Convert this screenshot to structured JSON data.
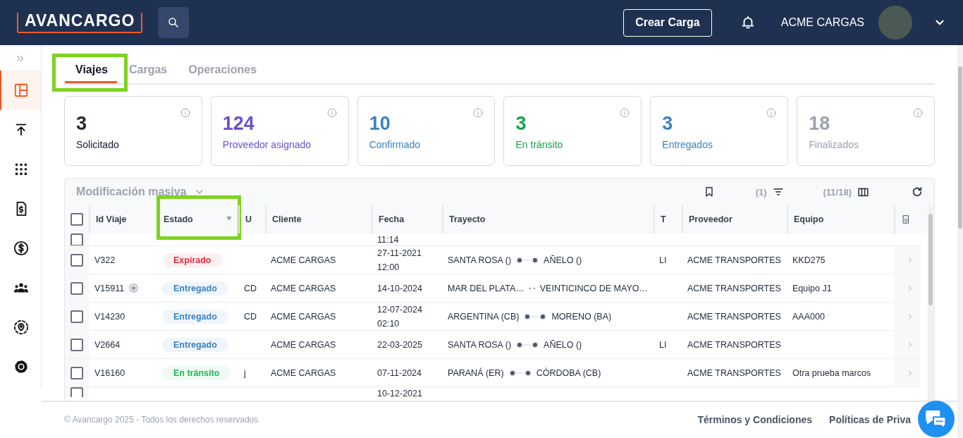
{
  "header": {
    "logo": "AVANCARGO",
    "create_button": "Crear Carga",
    "user_name": "ACME CARGAS"
  },
  "sidebar": {
    "items": [
      {
        "kind": "layout",
        "selected": true
      },
      {
        "kind": "upload",
        "selected": false
      },
      {
        "kind": "apps",
        "selected": false
      },
      {
        "kind": "invoice",
        "selected": false
      },
      {
        "kind": "dollar",
        "selected": false
      },
      {
        "kind": "group",
        "selected": false
      },
      {
        "kind": "location",
        "selected": false
      },
      {
        "kind": "settings",
        "selected": false
      }
    ]
  },
  "tabs": [
    {
      "label": "Viajes",
      "selected": true,
      "highlighted": true
    },
    {
      "label": "Cargas",
      "selected": false,
      "highlighted": false
    },
    {
      "label": "Operaciones",
      "selected": false,
      "highlighted": false
    }
  ],
  "summary_cards": [
    {
      "count": "3",
      "label": "Solicitado",
      "color": "#1f2937"
    },
    {
      "count": "124",
      "label": "Proveedor asignado",
      "color": "#6b4fcf"
    },
    {
      "count": "10",
      "label": "Confirmado",
      "color": "#3b82c4"
    },
    {
      "count": "3",
      "label": "En tránsito",
      "color": "#16a34a"
    },
    {
      "count": "3",
      "label": "Entregados",
      "color": "#3b82c4"
    },
    {
      "count": "18",
      "label": "Finalizados",
      "color": "#9ca3af"
    }
  ],
  "table": {
    "bulk_action": "Modificación masiva",
    "filter_count": "(1)",
    "column_count": "(11/18)",
    "all_checked": false,
    "columns": [
      {
        "label": "Id Viaje",
        "filter_icon": false,
        "highlighted": false
      },
      {
        "label": "Estado",
        "filter_icon": true,
        "highlighted": true
      },
      {
        "label": "U",
        "filter_icon": false,
        "highlighted": false
      },
      {
        "label": "Cliente",
        "filter_icon": false,
        "highlighted": false
      },
      {
        "label": "Fecha",
        "filter_icon": false,
        "highlighted": false
      },
      {
        "label": "Trayecto",
        "filter_icon": false,
        "highlighted": false
      },
      {
        "label": "T",
        "filter_icon": false,
        "highlighted": false
      },
      {
        "label": "Proveedor",
        "filter_icon": false,
        "highlighted": false
      },
      {
        "label": "Equipo",
        "filter_icon": false,
        "highlighted": false
      }
    ],
    "rows": [
      {
        "kind": "partial_top",
        "checked": false,
        "time": "11:14"
      },
      {
        "kind": "full",
        "checked": false,
        "id": "V322",
        "live_icon": false,
        "status": {
          "label": "Expirado",
          "kind": "expired"
        },
        "client": "ACME CARGAS",
        "date": "27-11-2021",
        "time": "12:00",
        "origin": "SANTA ROSA ()",
        "destination": "AÑELO ()",
        "t": "LI",
        "provider": "ACME TRANSPORTES",
        "equipment": "KKD275"
      },
      {
        "kind": "full",
        "checked": false,
        "id": "V15911",
        "live_icon": true,
        "status": {
          "label": "Entregado",
          "kind": "delivered"
        },
        "u": "CD",
        "client": "ACME CARGAS",
        "date": "14-10-2024",
        "origin": "MAR DEL PLATA…",
        "destination": "VEINTICINCO DE MAYO…",
        "provider": "ACME TRANSPORTES",
        "equipment": "Equipo J1"
      },
      {
        "kind": "full",
        "checked": false,
        "id": "V14230",
        "live_icon": false,
        "status": {
          "label": "Entregado",
          "kind": "delivered"
        },
        "u": "CD",
        "client": "ACME CARGAS",
        "date": "12-07-2024",
        "time": "02:10",
        "origin": "ARGENTINA (CB)",
        "destination": "MORENO (BA)",
        "provider": "ACME TRANSPORTES",
        "equipment": "AAA000"
      },
      {
        "kind": "full",
        "checked": false,
        "id": "V2664",
        "live_icon": false,
        "status": {
          "label": "Entregado",
          "kind": "delivered"
        },
        "client": "ACME CARGAS",
        "date": "22-03-2025",
        "origin": "SANTA ROSA ()",
        "destination": "AÑELO ()",
        "t": "LI",
        "provider": "ACME TRANSPORTES"
      },
      {
        "kind": "full",
        "checked": false,
        "id": "V16160",
        "live_icon": false,
        "status": {
          "label": "En tránsito",
          "kind": "transit"
        },
        "u": "j",
        "client": "ACME CARGAS",
        "date": "07-11-2024",
        "origin": "PARANÁ (ER)",
        "destination": "CÓRDOBA (CB)",
        "provider": "ACME TRANSPORTES",
        "equipment": "Otra prueba marcos"
      },
      {
        "kind": "partial_bottom",
        "checked": false,
        "date": "10-12-2021"
      }
    ]
  },
  "footer": {
    "copyright": "© Avancargo 2025 - Todos los derechos reservados",
    "links": [
      "Términos y Condiciones",
      "Políticas de Priva"
    ]
  }
}
